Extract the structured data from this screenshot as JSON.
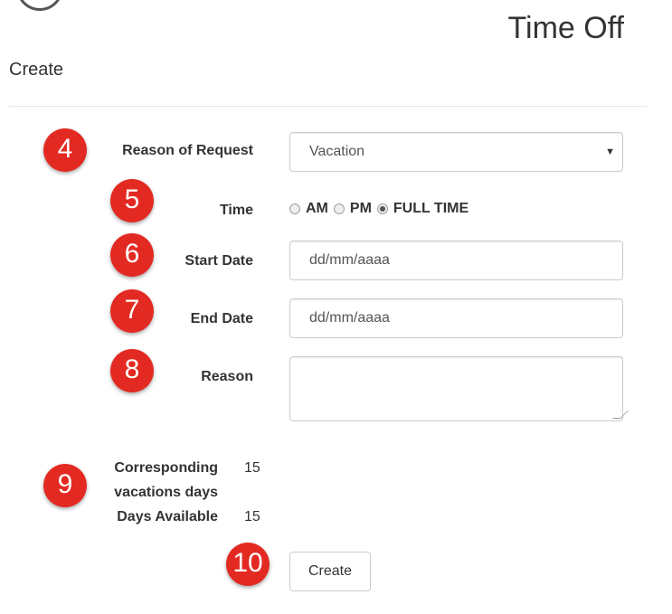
{
  "header": {
    "title": "Time Off",
    "subtitle": "Create"
  },
  "form": {
    "reason_of_request": {
      "label": "Reason of Request",
      "value": "Vacation",
      "marker": "4"
    },
    "time": {
      "label": "Time",
      "marker": "5",
      "options": [
        {
          "label": "AM",
          "checked": false
        },
        {
          "label": "PM",
          "checked": false
        },
        {
          "label": "FULL TIME",
          "checked": true
        }
      ]
    },
    "start_date": {
      "label": "Start Date",
      "placeholder": "dd/mm/aaaa",
      "marker": "6"
    },
    "end_date": {
      "label": "End Date",
      "placeholder": "dd/mm/aaaa",
      "marker": "7"
    },
    "reason": {
      "label": "Reason",
      "value": "",
      "marker": "8"
    }
  },
  "summary": {
    "marker": "9",
    "corresponding_label_line1": "Corresponding",
    "corresponding_label_line2": "vacations days",
    "corresponding_value": "15",
    "available_label": "Days Available",
    "available_value": "15"
  },
  "actions": {
    "create_label": "Create",
    "marker": "10"
  },
  "colors": {
    "marker": "#e32a22",
    "border": "#cccccc"
  }
}
